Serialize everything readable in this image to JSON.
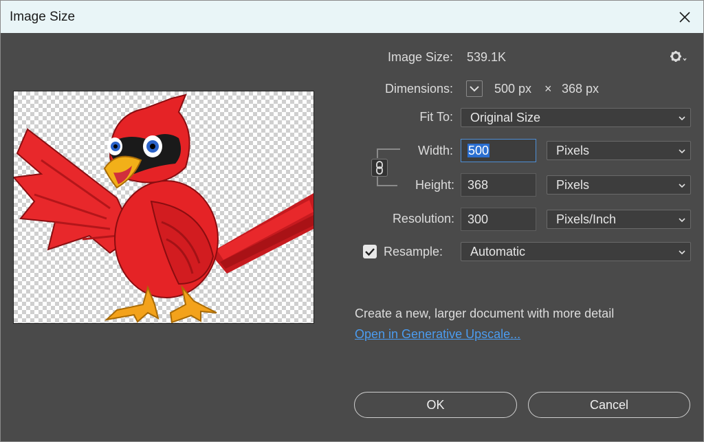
{
  "window": {
    "title": "Image Size"
  },
  "info": {
    "image_size_label": "Image Size:",
    "image_size_value": "539.1K",
    "dimensions_label": "Dimensions:",
    "dimensions_width": "500 px",
    "dimensions_sep": "×",
    "dimensions_height": "368 px"
  },
  "fit_to": {
    "label": "Fit To:",
    "value": "Original Size"
  },
  "width": {
    "label": "Width:",
    "value": "500",
    "unit": "Pixels"
  },
  "height": {
    "label": "Height:",
    "value": "368",
    "unit": "Pixels"
  },
  "resolution": {
    "label": "Resolution:",
    "value": "300",
    "unit": "Pixels/Inch"
  },
  "resample": {
    "label": "Resample:",
    "checked": true,
    "value": "Automatic"
  },
  "upscale": {
    "description": "Create a new, larger document with more detail",
    "link": "Open in Generative Upscale..."
  },
  "buttons": {
    "ok": "OK",
    "cancel": "Cancel"
  },
  "icons": {
    "close": "close-icon",
    "gear": "gear-icon",
    "dimensions_toggle": "chevron-down-icon",
    "link": "link-chain-icon",
    "checkbox": "checkmark-icon"
  },
  "colors": {
    "accent": "#4f8fd6",
    "link": "#4b9cf0",
    "dialog_bg": "#4a4a4a",
    "titlebar_bg": "#e9f5f7"
  }
}
